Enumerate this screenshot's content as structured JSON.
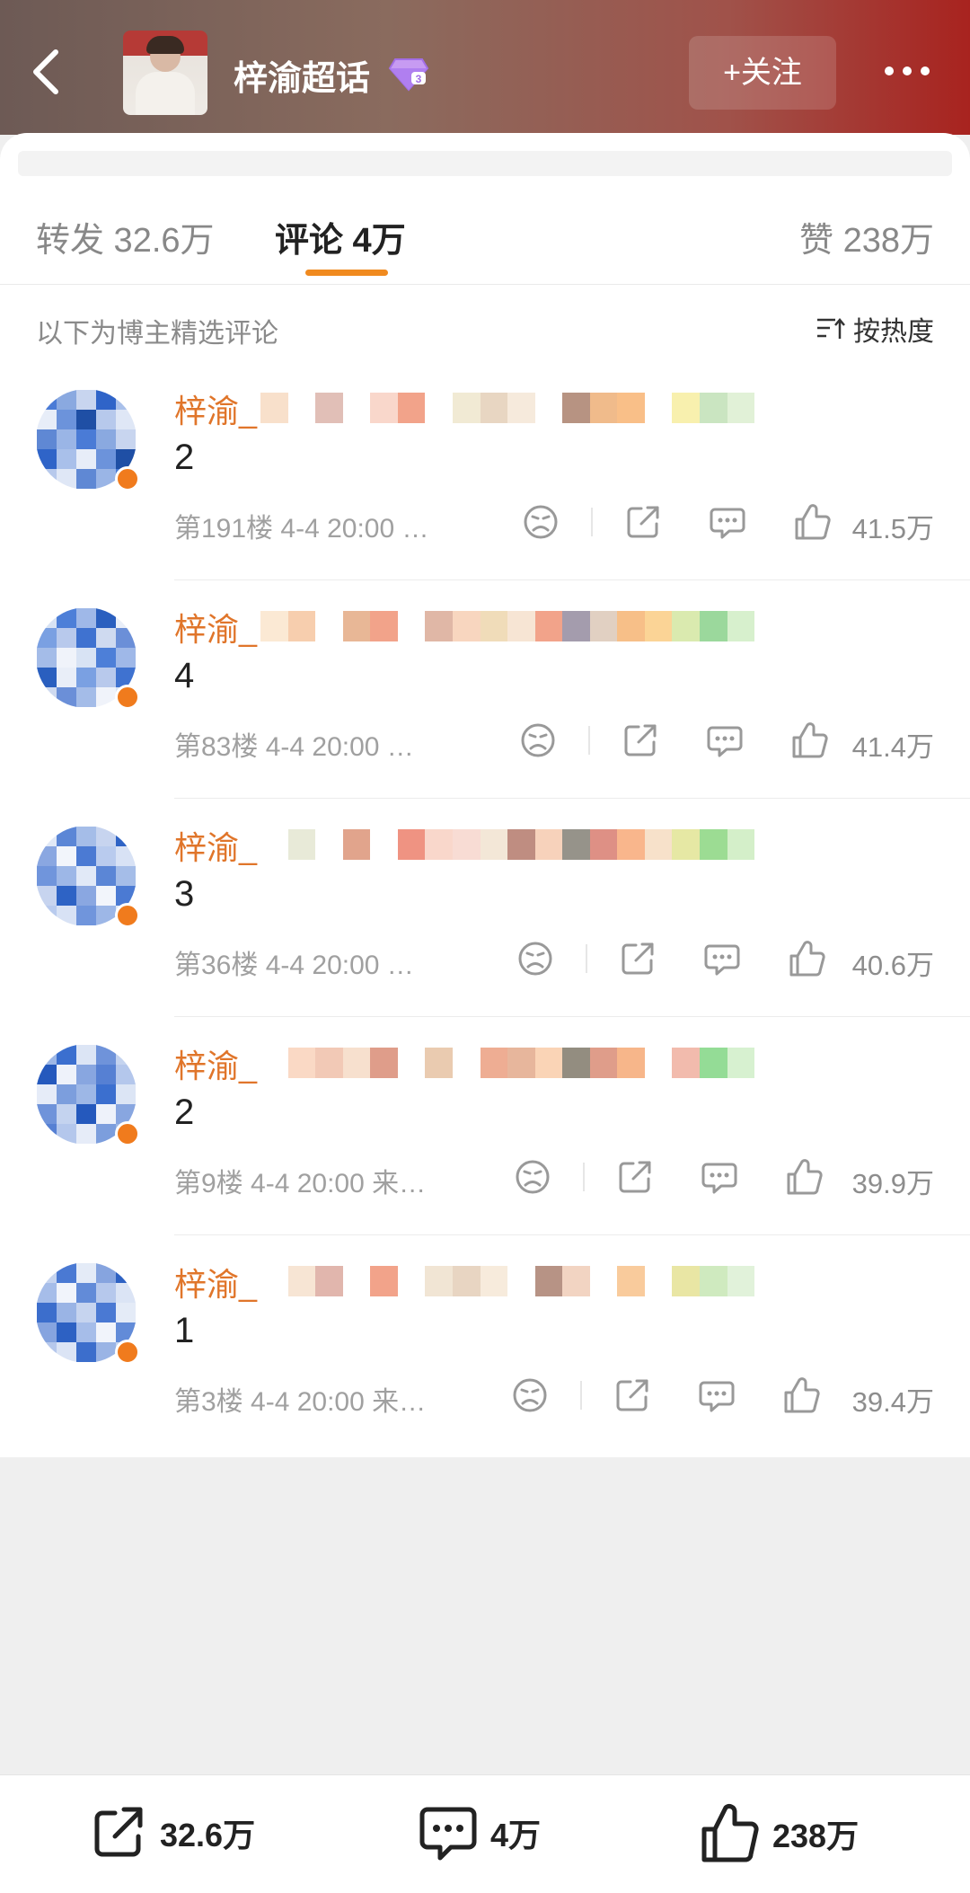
{
  "header": {
    "title": "梓渝超话",
    "follow_label": "+关注"
  },
  "tabs": {
    "repost": "转发 32.6万",
    "comment": "评论 4万",
    "like": "赞 238万"
  },
  "subheader": {
    "note": "以下为博主精选评论",
    "sort_label": "按热度"
  },
  "comments": [
    {
      "name": "梓渝_",
      "text": "2",
      "meta": "第191楼 4-4 20:00 …",
      "likes": "41.5万"
    },
    {
      "name": "梓渝_",
      "text": "4",
      "meta": "第83楼 4-4 20:00 …",
      "likes": "41.4万"
    },
    {
      "name": "梓渝_",
      "text": "3",
      "meta": "第36楼 4-4 20:00 …",
      "likes": "40.6万"
    },
    {
      "name": "梓渝_",
      "text": "2",
      "meta": "第9楼 4-4 20:00 来…",
      "likes": "39.9万"
    },
    {
      "name": "梓渝_",
      "text": "1",
      "meta": "第3楼 4-4 20:00 来…",
      "likes": "39.4万"
    }
  ],
  "bottom_bar": {
    "repost_count": "32.6万",
    "comment_count": "4万",
    "like_count": "238万"
  },
  "colors": {
    "accent_orange": "#f08a1f",
    "username": "#e0752a"
  }
}
